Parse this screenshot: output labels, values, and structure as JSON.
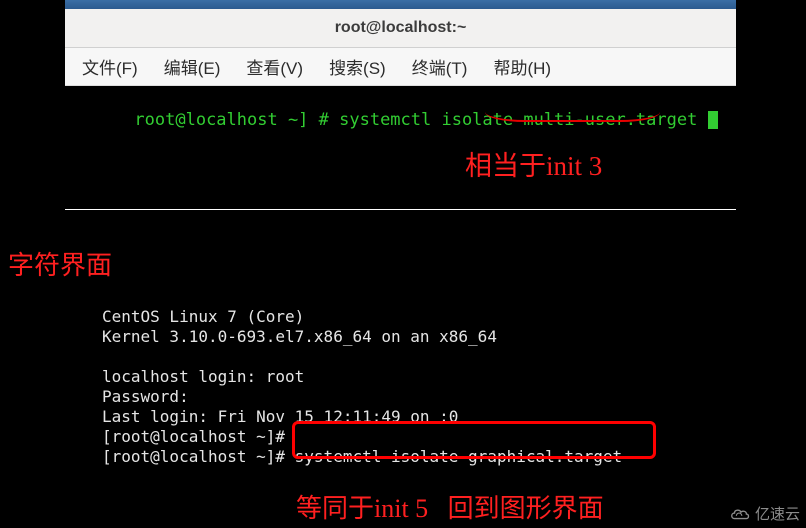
{
  "window": {
    "title": "root@localhost:~"
  },
  "menu": {
    "file": "文件(F)",
    "edit": "编辑(E)",
    "view": "查看(V)",
    "search": "搜索(S)",
    "terminal": "终端(T)",
    "help": "帮助(H)"
  },
  "term1": {
    "prompt": "root@localhost ~] # ",
    "command": "systemctl isolate multi-user.target "
  },
  "annotation1": "相当于init 3",
  "char_ui_label": "字符界面",
  "console": {
    "line1": "CentOS Linux 7 (Core)",
    "line2": "Kernel 3.10.0-693.el7.x86_64 on an x86_64",
    "blank1": "",
    "line3": "localhost login: root",
    "line4": "Password:",
    "line5": "Last login: Fri Nov 15 12:11:49 on :0",
    "line6": "[root@localhost ~]#",
    "line7": "[root@localhost ~]# systemctl isolate graphical.target"
  },
  "annotation2": "等同于init 5   回到图形界面",
  "watermark": "亿速云"
}
